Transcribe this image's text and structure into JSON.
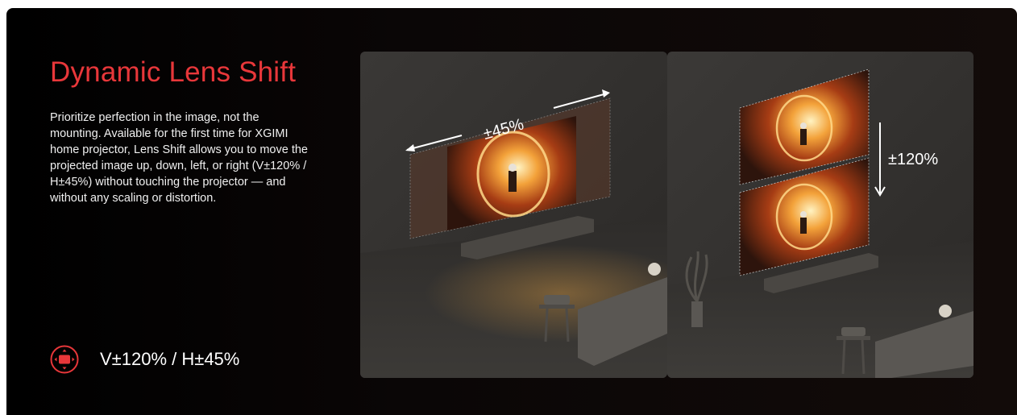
{
  "feature": {
    "title": "Dynamic Lens Shift",
    "description": "Prioritize perfection in the image, not the mounting. Available for the first time for XGIMI home projector, Lens Shift allows you to move the projected image up, down, left, or right (V±120% / H±45%) without touching the projector — and without any scaling or distortion.",
    "spec_icon": "lens-shift-icon",
    "spec_text": "V±120% / H±45%"
  },
  "images": [
    {
      "name": "horizontal-shift",
      "overlay_label": "±45%"
    },
    {
      "name": "vertical-shift",
      "overlay_label": "±120%"
    }
  ],
  "colors": {
    "accent": "#e8373a",
    "background": "#000000",
    "text": "#ffffff"
  }
}
